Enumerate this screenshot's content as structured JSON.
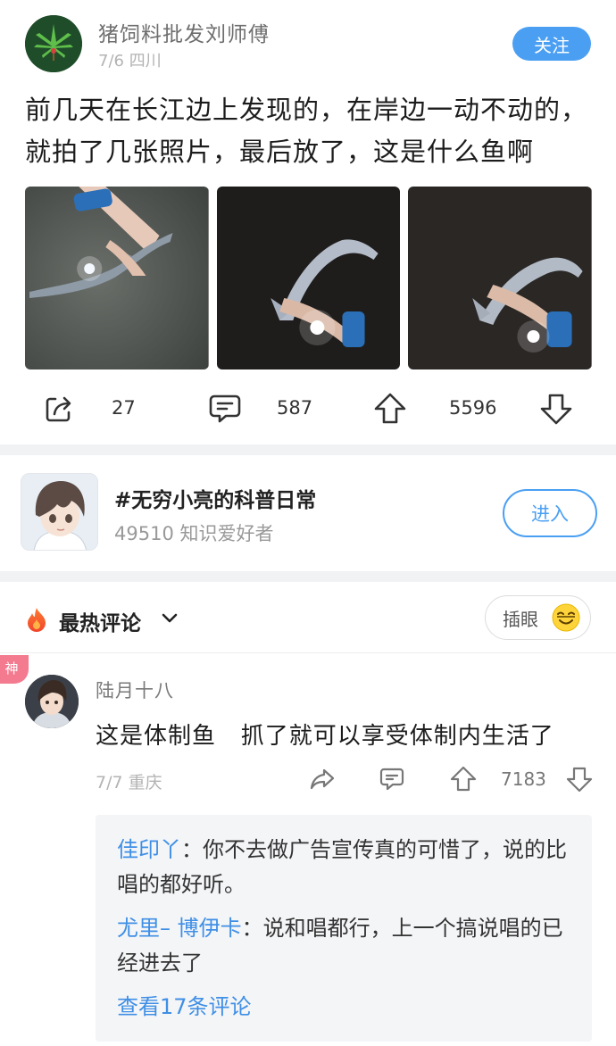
{
  "post": {
    "author": "猪饲料批发刘师傅",
    "date": "7/6",
    "location": "四川",
    "follow_label": "关注",
    "text_line1": "前几天在长江边上发现的，在岸边一动不动的，",
    "text_line2": "就拍了几张照片，最后放了，这是什么鱼啊",
    "share_count": "27",
    "comment_count": "587",
    "upvote_count": "5596"
  },
  "topic": {
    "name": "#无穷小亮的科普日常",
    "stat": "49510 知识爱好者",
    "enter_label": "进入"
  },
  "hot": {
    "title": "最热评论",
    "insert_eye_label": "插眼"
  },
  "comment": {
    "badge": "神",
    "author": "陆月十八",
    "text": "这是体制鱼   抓了就可以享受体制内生活了",
    "date": "7/7",
    "location": "重庆",
    "like_count": "7183",
    "replies": [
      {
        "user": "佳印丫",
        "sep": "：",
        "text": "你不去做广告宣传真的可惜了，说的比唱的都好听。"
      },
      {
        "user": "尤里– 博伊卡",
        "sep": "：",
        "text": "说和唱都行，上一个搞说唱的已经进去了"
      }
    ],
    "view_more": "查看17条评论"
  },
  "colors": {
    "accent_blue": "#4a9ff3",
    "link_blue": "#3f8fe6",
    "god_badge": "#f37a8f"
  }
}
